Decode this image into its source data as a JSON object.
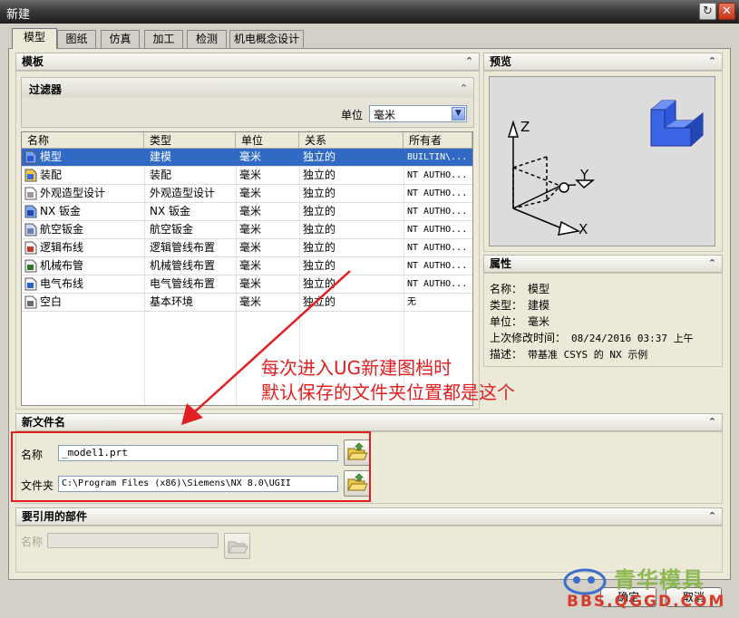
{
  "window": {
    "title": "新建"
  },
  "tabs": [
    {
      "label": "模型",
      "active": true
    },
    {
      "label": "图纸"
    },
    {
      "label": "仿真"
    },
    {
      "label": "加工"
    },
    {
      "label": "检测"
    },
    {
      "label": "机电概念设计"
    }
  ],
  "templates": {
    "header": "模板",
    "filter": {
      "header": "过滤器",
      "unit_label": "单位",
      "unit_value": "毫米"
    },
    "columns": [
      "名称",
      "类型",
      "单位",
      "关系",
      "所有者"
    ],
    "rows": [
      {
        "name": "模型",
        "type": "建模",
        "unit": "毫米",
        "relation": "独立的",
        "owner": "BUILTIN\\...",
        "icon": "model-icon",
        "selected": true
      },
      {
        "name": "装配",
        "type": "装配",
        "unit": "毫米",
        "relation": "独立的",
        "owner": "NT AUTHO...",
        "icon": "assembly-icon"
      },
      {
        "name": "外观造型设计",
        "type": "外观造型设计",
        "unit": "毫米",
        "relation": "独立的",
        "owner": "NT AUTHO...",
        "icon": "shape-studio-icon"
      },
      {
        "name": "NX 钣金",
        "type": "NX 钣金",
        "unit": "毫米",
        "relation": "独立的",
        "owner": "NT AUTHO...",
        "icon": "sheet-metal-icon"
      },
      {
        "name": "航空钣金",
        "type": "航空钣金",
        "unit": "毫米",
        "relation": "独立的",
        "owner": "NT AUTHO...",
        "icon": "aero-sheet-metal-icon"
      },
      {
        "name": "逻辑布线",
        "type": "逻辑管线布置",
        "unit": "毫米",
        "relation": "独立的",
        "owner": "NT AUTHO...",
        "icon": "logical-routing-icon"
      },
      {
        "name": "机械布管",
        "type": "机械管线布置",
        "unit": "毫米",
        "relation": "独立的",
        "owner": "NT AUTHO...",
        "icon": "mechanical-routing-icon"
      },
      {
        "name": "电气布线",
        "type": "电气管线布置",
        "unit": "毫米",
        "relation": "独立的",
        "owner": "NT AUTHO...",
        "icon": "electrical-routing-icon"
      },
      {
        "name": "空白",
        "type": "基本环境",
        "unit": "毫米",
        "relation": "独立的",
        "owner": "无",
        "icon": "blank-file-icon"
      }
    ]
  },
  "preview": {
    "header": "预览",
    "axis_x": "X",
    "axis_y": "Y",
    "axis_z": "Z"
  },
  "properties": {
    "header": "属性",
    "items": [
      {
        "label": "名称：",
        "value": "模型"
      },
      {
        "label": "类型：",
        "value": "建模"
      },
      {
        "label": "单位：",
        "value": "毫米"
      },
      {
        "label": "上次修改时间：",
        "value": "08/24/2016 03:37 上午"
      },
      {
        "label": "描述：",
        "value": "带基准 CSYS 的 NX 示例"
      }
    ]
  },
  "annotation": {
    "line1": "每次进入UG新建图档时",
    "line2": "默认保存的文件夹位置都是这个",
    "color": "#e02020"
  },
  "new_file": {
    "header": "新文件名",
    "name_label": "名称",
    "name_value": "_model1.prt",
    "folder_label": "文件夹",
    "folder_value": "C:\\Program Files (x86)\\Siemens\\NX 8.0\\UGII"
  },
  "referenced_part": {
    "header": "要引用的部件",
    "name_label": "名称"
  },
  "footer": {
    "ok_label": "确定",
    "cancel_label": "取消"
  },
  "watermark": {
    "brand": "青华模具",
    "url": "BBS.QGGD.COM"
  }
}
